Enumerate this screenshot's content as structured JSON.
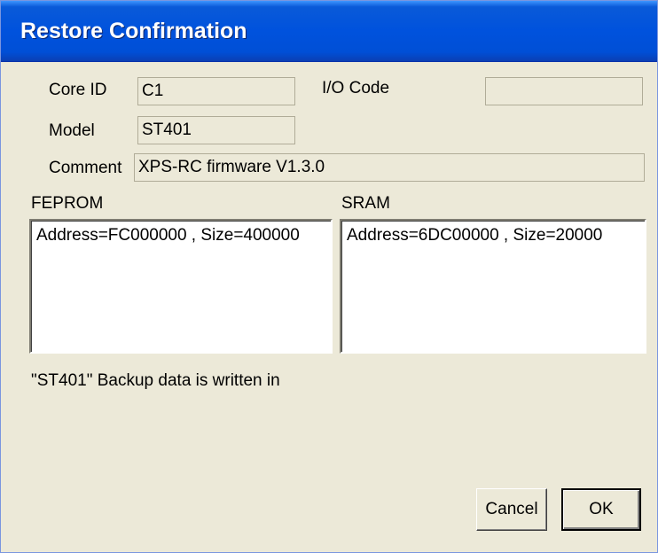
{
  "window": {
    "title": "Restore Confirmation"
  },
  "fields": {
    "core_id": {
      "label": "Core ID",
      "value": "C1"
    },
    "io_code": {
      "label": "I/O Code",
      "value": ""
    },
    "model": {
      "label": "Model",
      "value": "ST401"
    },
    "comment": {
      "label": "Comment",
      "value": "XPS-RC firmware V1.3.0"
    }
  },
  "feprom": {
    "label": "FEPROM",
    "items": [
      "Address=FC000000 , Size=400000"
    ]
  },
  "sram": {
    "label": "SRAM",
    "items": [
      "Address=6DC00000 , Size=20000"
    ]
  },
  "status_text": "\"ST401\" Backup data is written in",
  "buttons": {
    "cancel": "Cancel",
    "ok": "OK"
  }
}
